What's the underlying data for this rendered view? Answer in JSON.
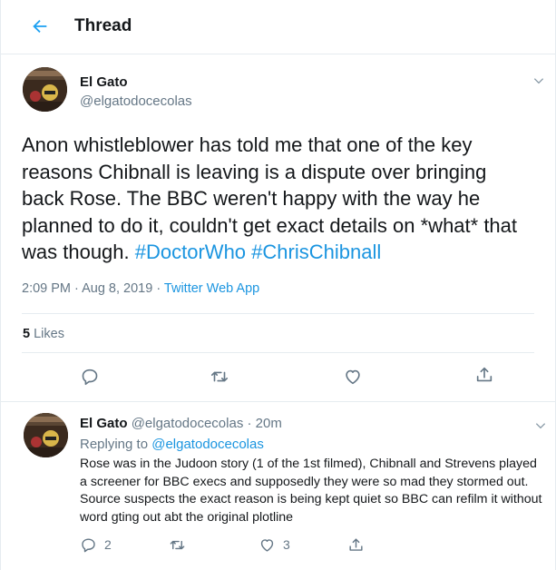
{
  "header": {
    "title": "Thread"
  },
  "main_tweet": {
    "name": "El Gato",
    "handle": "@elgatodocecolas",
    "text_plain": "Anon whistleblower has told me that one of the key reasons Chibnall is leaving is a dispute over bringing back Rose. The BBC weren't happy with the way he planned to do it, couldn't get exact details on *what* that was though.",
    "hashtag1": "#DoctorWho",
    "hashtag2": "#ChrisChibnall",
    "timestamp": "2:09 PM · Aug 8, 2019 · ",
    "source": "Twitter Web App",
    "like_count": "5",
    "likes_label": "Likes"
  },
  "reply_tweet": {
    "name": "El Gato",
    "handle_time": "@elgatodocecolas · 20m",
    "replying_prefix": "Replying to ",
    "replying_to": "@elgatodocecolas",
    "text": "Rose was in the Judoon story (1 of the 1st filmed), Chibnall and Strevens played a screener for BBC execs and supposedly they were so mad they stormed out. Source suspects the exact reason is being kept quiet so BBC can refilm it without word gting out abt the original plotline",
    "reply_count": "2",
    "retweet_count": "",
    "like_count": "3"
  },
  "icons": {
    "back": "arrow-left-icon",
    "reply": "reply-icon",
    "retweet": "retweet-icon",
    "like": "heart-icon",
    "share": "share-icon",
    "more": "chevron-down-icon"
  },
  "colors": {
    "accent": "#1da1f2",
    "link": "#1b95e0",
    "secondary_text": "#657786",
    "divider": "#e6ecf0"
  }
}
